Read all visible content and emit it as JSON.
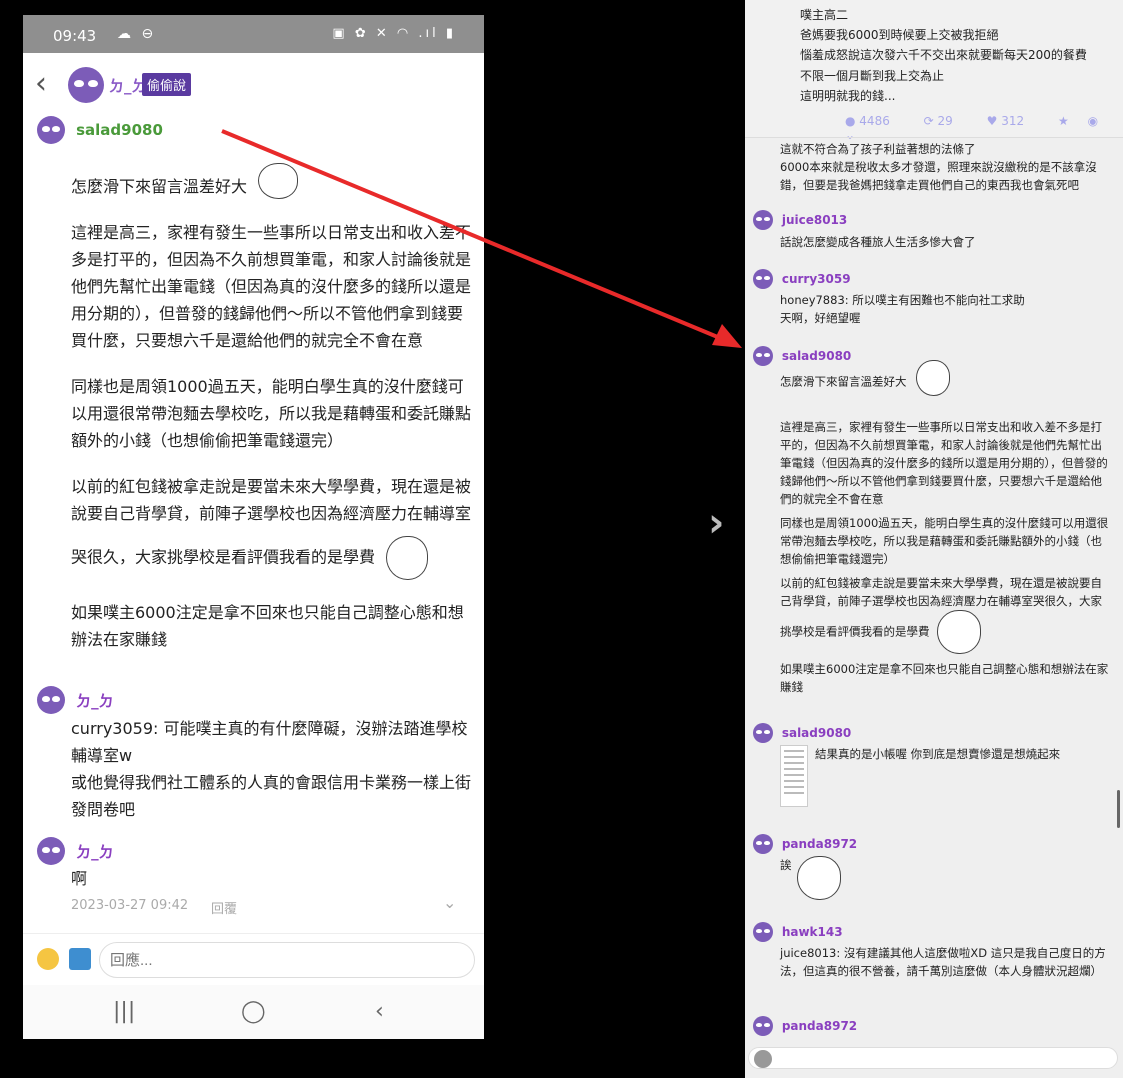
{
  "status_bar": {
    "time": "09:43",
    "left_icons": "☁ ⊖",
    "right_icons": "▣ ✿ ✕ ◠ .ıl ▮"
  },
  "header": {
    "back": "‹",
    "name": "ㄉ_ㄉ",
    "tag": "偷偷說"
  },
  "left_comments": [
    {
      "author": "salad9080",
      "paragraphs": [
        "怎麼滑下來留言溫差好大",
        "這裡是高三，家裡有發生一些事所以日常支出和收入差不多是打平的，但因為不久前想買筆電，和家人討論後就是他們先幫忙出筆電錢（但因為真的沒什麼多的錢所以還是用分期的），但普發的錢歸他們～所以不管他們拿到錢要買什麼，只要想六千是還給他們的就完全不會在意",
        "同樣也是周領1000過五天，能明白學生真的沒什麼錢可以用還很常帶泡麵去學校吃，所以我是藉轉蛋和委託賺點額外的小錢（也想偷偷把筆電錢還完）",
        "以前的紅包錢被拿走說是要當未來大學學費，現在還是被說要自己背學貸，前陣子選學校也因為經濟壓力在輔導室",
        "哭很久，大家挑學校是看評價我看的是學費",
        "如果噗主6000注定是拿不回來也只能自己調整心態和想辦法在家賺錢"
      ]
    },
    {
      "author": "ㄉ_ㄉ",
      "paragraphs": [
        "curry3059: 可能噗主真的有什麼障礙，沒辦法踏進學校輔導室w",
        "或他覺得我們社工體系的人真的會跟信用卡業務一樣上街發問卷吧"
      ]
    },
    {
      "author": "ㄉ_ㄉ",
      "paragraphs": [
        "啊"
      ]
    }
  ],
  "left_meta": {
    "timestamp": "2023-03-27 09:42",
    "reply": "回覆",
    "chevron": "⌄"
  },
  "reply_bar": {
    "placeholder": "回應..."
  },
  "nav_bar": {
    "recent": "|||",
    "home": "◯",
    "back": "‹"
  },
  "next_chevron": "›",
  "op": {
    "lines": [
      "噗主高二",
      "爸媽要我6000到時候要上交被我拒絕",
      "惱羞成怒說這次發六千不交出來就要斷每天200的餐費",
      "不限一個月斷到我上交為止",
      "這明明就我的錢..."
    ],
    "stats": {
      "comments": "4486",
      "replurks": "29",
      "likes": "312"
    }
  },
  "right_comments": [
    {
      "author": "",
      "paragraphs": [
        "這就不符合為了孩子利益著想的法條了",
        "6000本來就是稅收太多才發還，照理來說沒繳稅的是不該拿沒錯，但要是我爸媽把錢拿走買他們自己的東西我也會氣死吧"
      ]
    },
    {
      "author": "juice8013",
      "paragraphs": [
        "話說怎麼變成各種旅人生活多慘大會了"
      ]
    },
    {
      "author": "curry3059",
      "paragraphs": [
        "honey7883: 所以噗主有困難也不能向社工求助",
        "天啊，好絕望喔"
      ]
    },
    {
      "author": "salad9080",
      "paragraphs": [
        "怎麼滑下來留言溫差好大",
        "這裡是高三，家裡有發生一些事所以日常支出和收入差不多是打平的，但因為不久前想買筆電，和家人討論後就是他們先幫忙出筆電錢（但因為真的沒什麼多的錢所以還是用分期的），但普發的錢歸他們～所以不管他們拿到錢要買什麼，只要想六千是還給他們的就完全不會在意",
        "同樣也是周領1000過五天，能明白學生真的沒什麼錢可以用還很常帶泡麵去學校吃，所以我是藉轉蛋和委託賺點額外的小錢（也想偷偷把筆電錢還完）",
        "以前的紅包錢被拿走說是要當未來大學學費，現在還是被說要自己背學貸，前陣子選學校也因為經濟壓力在輔導室哭很久，大家挑學校是看評價我看的是學費",
        "如果噗主6000注定是拿不回來也只能自己調整心態和想辦法在家賺錢"
      ]
    },
    {
      "author": "salad9080",
      "paragraphs": [
        "結果真的是小帳喔 你到底是想賣慘還是想燒起來"
      ]
    },
    {
      "author": "panda8972",
      "paragraphs": [
        "誒"
      ]
    },
    {
      "author": "hawk143",
      "paragraphs": [
        "juice8013: 沒有建議其他人這麼做啦XD 這只是我自己度日的方法，但這真的很不營養，請千萬別這麼做（本人身體狀況超爛）"
      ]
    },
    {
      "author": "panda8972",
      "paragraphs": []
    }
  ],
  "colors": {
    "purple": "#7c5cb8",
    "name_purple": "#8a3fc0",
    "green_name": "#4a9a3a",
    "arrow_red": "#e82a2a"
  },
  "icons": [
    "mask-avatar-icon",
    "back-arrow-icon",
    "emoji-icon",
    "image-icon",
    "chevron-right-icon",
    "comment-icon",
    "replurk-icon",
    "heart-icon",
    "star-icon",
    "mute-icon",
    "chevron-down-icon"
  ]
}
